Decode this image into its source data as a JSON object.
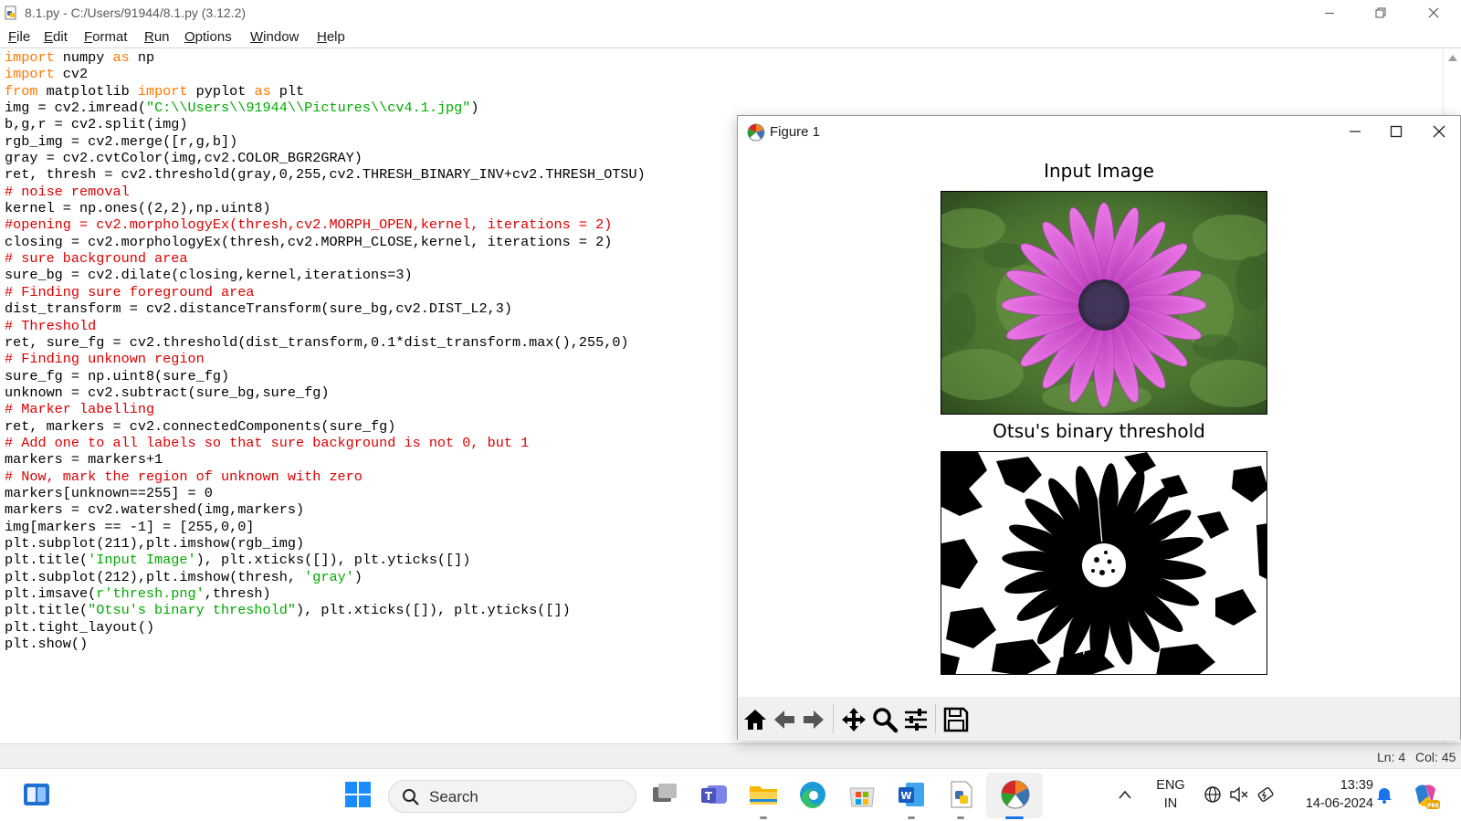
{
  "window": {
    "title": "8.1.py - C:/Users/91944/8.1.py (3.12.2)",
    "icon": "python-file-icon"
  },
  "menu": [
    "File",
    "Edit",
    "Format",
    "Run",
    "Options",
    "Window",
    "Help"
  ],
  "code_lines": [
    [
      [
        "kw",
        "import"
      ],
      [
        "n",
        " numpy "
      ],
      [
        "kw",
        "as"
      ],
      [
        "n",
        " np"
      ]
    ],
    [
      [
        "kw",
        "import"
      ],
      [
        "n",
        " cv2"
      ]
    ],
    [
      [
        "kw",
        "from"
      ],
      [
        "n",
        " matplotlib "
      ],
      [
        "kw",
        "import"
      ],
      [
        "n",
        " pyplot "
      ],
      [
        "kw",
        "as"
      ],
      [
        "n",
        " plt"
      ]
    ],
    [
      [
        "n",
        "img = cv2.imread("
      ],
      [
        "st",
        "\"C:\\\\Users\\\\91944\\\\Pictures\\\\cv4.1.jpg\""
      ],
      [
        "n",
        ")"
      ]
    ],
    [
      [
        "n",
        "b,g,r = cv2.split(img)"
      ]
    ],
    [
      [
        "n",
        "rgb_img = cv2.merge([r,g,b])"
      ]
    ],
    [
      [
        "n",
        "gray = cv2.cvtColor(img,cv2.COLOR_BGR2GRAY)"
      ]
    ],
    [
      [
        "n",
        "ret, thresh = cv2.threshold(gray,0,255,cv2.THRESH_BINARY_INV+cv2.THRESH_OTSU)"
      ]
    ],
    [
      [
        "cm",
        "# noise removal"
      ]
    ],
    [
      [
        "n",
        "kernel = np.ones((2,2),np.uint8)"
      ]
    ],
    [
      [
        "cm",
        "#opening = cv2.morphologyEx(thresh,cv2.MORPH_OPEN,kernel, iterations = 2)"
      ]
    ],
    [
      [
        "n",
        "closing = cv2.morphologyEx(thresh,cv2.MORPH_CLOSE,kernel, iterations = 2)"
      ]
    ],
    [
      [
        "cm",
        "# sure background area"
      ]
    ],
    [
      [
        "n",
        "sure_bg = cv2.dilate(closing,kernel,iterations=3)"
      ]
    ],
    [
      [
        "cm",
        "# Finding sure foreground area"
      ]
    ],
    [
      [
        "n",
        "dist_transform = cv2.distanceTransform(sure_bg,cv2.DIST_L2,3)"
      ]
    ],
    [
      [
        "cm",
        "# Threshold"
      ]
    ],
    [
      [
        "n",
        "ret, sure_fg = cv2.threshold(dist_transform,0.1*dist_transform.max(),255,0)"
      ]
    ],
    [
      [
        "cm",
        "# Finding unknown region"
      ]
    ],
    [
      [
        "n",
        "sure_fg = np.uint8(sure_fg)"
      ]
    ],
    [
      [
        "n",
        "unknown = cv2.subtract(sure_bg,sure_fg)"
      ]
    ],
    [
      [
        "cm",
        "# Marker labelling"
      ]
    ],
    [
      [
        "n",
        "ret, markers = cv2.connectedComponents(sure_fg)"
      ]
    ],
    [
      [
        "cm",
        "# Add one to all labels so that sure background is not 0, but 1"
      ]
    ],
    [
      [
        "n",
        "markers = markers+1"
      ]
    ],
    [
      [
        "cm",
        "# Now, mark the region of unknown with zero"
      ]
    ],
    [
      [
        "n",
        "markers[unknown==255] = 0"
      ]
    ],
    [
      [
        "n",
        "markers = cv2.watershed(img,markers)"
      ]
    ],
    [
      [
        "n",
        "img[markers == -1] = [255,0,0]"
      ]
    ],
    [
      [
        "n",
        "plt.subplot(211),plt.imshow(rgb_img)"
      ]
    ],
    [
      [
        "n",
        "plt.title("
      ],
      [
        "st",
        "'Input Image'"
      ],
      [
        "n",
        "), plt.xticks([]), plt.yticks([])"
      ]
    ],
    [
      [
        "n",
        "plt.subplot(212),plt.imshow(thresh, "
      ],
      [
        "st",
        "'gray'"
      ],
      [
        "n",
        ")"
      ]
    ],
    [
      [
        "n",
        "plt.imsave("
      ],
      [
        "st",
        "r'thresh.png'"
      ],
      [
        "n",
        ",thresh)"
      ]
    ],
    [
      [
        "n",
        "plt.title("
      ],
      [
        "st",
        "\"Otsu's binary threshold\""
      ],
      [
        "n",
        "), plt.xticks([]), plt.yticks([])"
      ]
    ],
    [
      [
        "n",
        "plt.tight_layout()"
      ]
    ],
    [
      [
        "n",
        "plt.show()"
      ]
    ]
  ],
  "status": {
    "line": "Ln: 4",
    "col": "Col: 45"
  },
  "figure": {
    "title": "Figure 1",
    "plot1_title": "Input Image",
    "plot2_title": "Otsu's binary threshold",
    "toolbar": [
      "home-icon",
      "back-arrow-icon",
      "forward-arrow-icon",
      "pan-move-icon",
      "zoom-magnifier-icon",
      "configure-subplots-icon",
      "save-floppy-icon"
    ]
  },
  "taskbar": {
    "search_placeholder": "Search",
    "pinned": [
      "widgets-icon",
      "windows-start-icon",
      "task-view-icon",
      "teams-icon",
      "file-explorer-icon",
      "edge-browser-icon",
      "microsoft-store-icon",
      "word-icon",
      "python-idle-icon",
      "matplotlib-figure-icon"
    ],
    "lang_top": "ENG",
    "lang_bottom": "IN",
    "time": "13:39",
    "date": "14-06-2024"
  },
  "colors": {
    "keyword": "#ff7700",
    "string": "#00aa00",
    "comment": "#dd0000",
    "toolbar_bg": "#f0f0f0",
    "flower_petal": "#d44fd6",
    "flower_center": "#4a3d5e",
    "leaf_green": "#4f7a36"
  }
}
